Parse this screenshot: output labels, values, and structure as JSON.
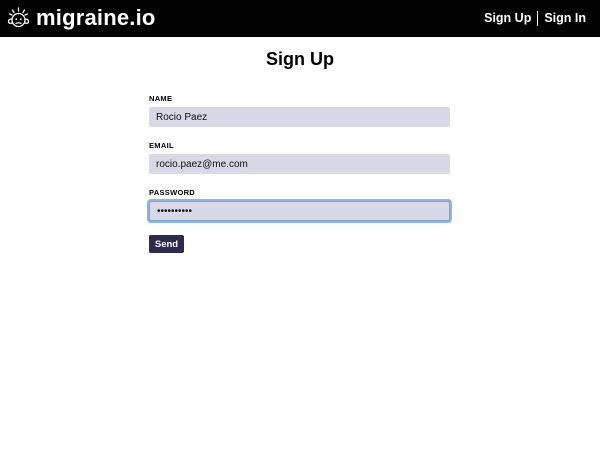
{
  "header": {
    "logo_icon": "head-with-headache-icon",
    "brand": "migraine.io",
    "nav": [
      {
        "label": "Sign Up"
      },
      {
        "label": "Sign In"
      }
    ]
  },
  "page": {
    "title": "Sign Up"
  },
  "form": {
    "fields": [
      {
        "label": "NAME",
        "value": "Rocio Paez",
        "type": "text"
      },
      {
        "label": "EMAIL",
        "value": "rocio.paez@me.com",
        "type": "email"
      },
      {
        "label": "PASSWORD",
        "value": "••••••••••",
        "type": "password",
        "focused": true
      }
    ],
    "submit_label": "Send"
  },
  "colors": {
    "navbar_bg": "#000000",
    "input_bg": "#d9d8e6",
    "button_bg": "#2d2a4f",
    "focus_ring": "#8ab6e6"
  }
}
